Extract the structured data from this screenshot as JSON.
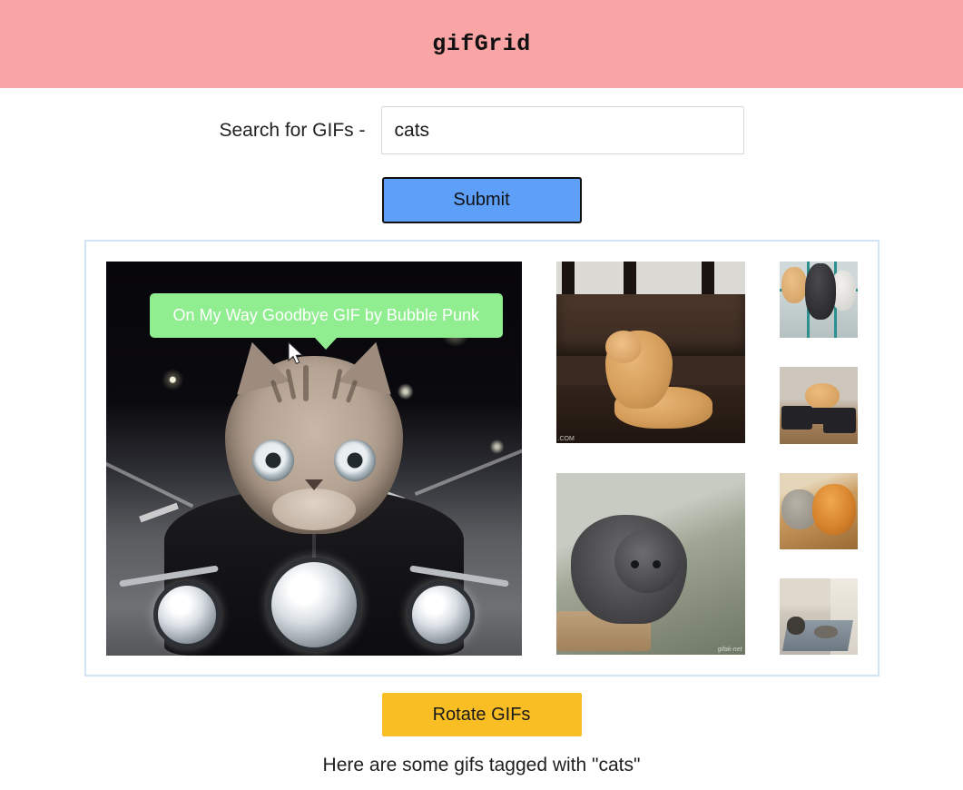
{
  "header": {
    "title": "gifGrid",
    "background_color": "#FAA5A5"
  },
  "search": {
    "label": "Search for GIFs -",
    "value": "cats",
    "placeholder": "",
    "submit_label": "Submit",
    "submit_color": "#5E9FF8"
  },
  "tooltip": {
    "text": "On My Way Goodbye GIF by Bubble Punk",
    "background_color": "#90EE90",
    "text_color": "#FFFFFF"
  },
  "grid": {
    "border_color": "#D2E3F7",
    "primary_gif": {
      "name": "cat-riding-motorcycle",
      "alt": "Tabby cat head on a biker riding a motorcycle at night"
    },
    "mid_gifs": [
      {
        "name": "orange-cats-couch",
        "alt": "Two orange cats play fighting on a brown leather couch",
        "watermark": ".COM"
      },
      {
        "name": "grey-kitten-box",
        "alt": "Grey kitten climbing out of a cardboard box",
        "watermark": "gifak-net"
      }
    ],
    "small_gifs": [
      {
        "name": "cats-in-cage",
        "alt": "Orange, black and white cats behind a teal cage"
      },
      {
        "name": "cat-dj-decks",
        "alt": "Ginger cat standing on DJ turntables"
      },
      {
        "name": "cats-cuddling",
        "alt": "Orange and grey cats cuddling on a bed"
      },
      {
        "name": "cat-in-hallway",
        "alt": "Dark cat walking down a hallway rug"
      }
    ]
  },
  "footer": {
    "rotate_label": "Rotate GIFs",
    "rotate_color": "#F9BE23",
    "status_text": "Here are some gifs tagged with \"cats\""
  }
}
